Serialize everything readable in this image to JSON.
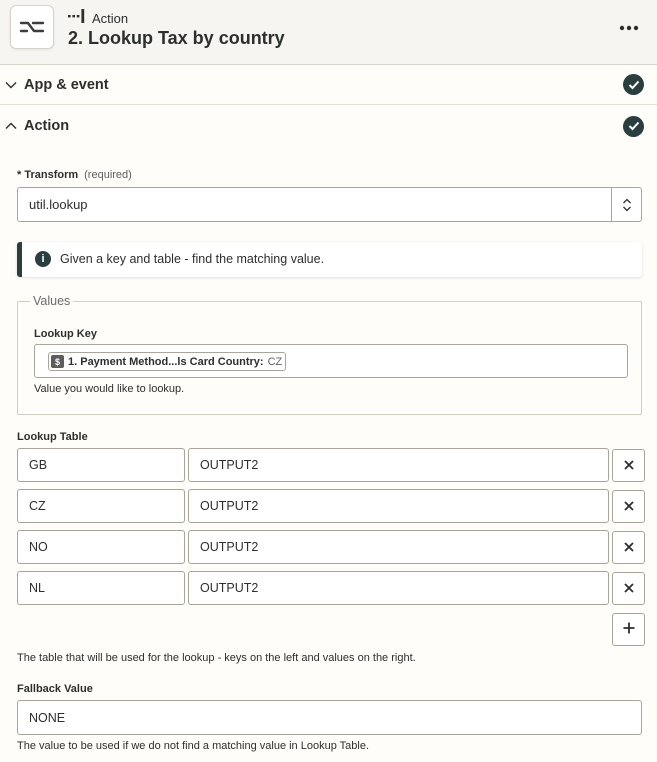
{
  "header": {
    "step_kind": "Action",
    "title": "2. Lookup Tax by country"
  },
  "sections": [
    {
      "label": "App & event",
      "expanded": false,
      "complete": true
    },
    {
      "label": "Action",
      "expanded": true,
      "complete": true
    }
  ],
  "transform": {
    "asterisk": "*",
    "label": "Transform",
    "required": "(required)",
    "value": "util.lookup"
  },
  "info": {
    "text": "Given a key and table - find the matching value."
  },
  "values_group": {
    "legend": "Values",
    "lookup_key": {
      "label": "Lookup Key",
      "pill_label": "1. Payment Method...ls Card Country:",
      "pill_value": "CZ",
      "help": "Value you would like to lookup."
    }
  },
  "lookup_table": {
    "label": "Lookup Table",
    "rows": [
      {
        "key": "GB",
        "value": "OUTPUT2"
      },
      {
        "key": "CZ",
        "value": "OUTPUT2"
      },
      {
        "key": "NO",
        "value": "OUTPUT2"
      },
      {
        "key": "NL",
        "value": "OUTPUT2"
      }
    ],
    "help": "The table that will be used for the lookup - keys on the left and values on the right."
  },
  "fallback": {
    "label": "Fallback Value",
    "value": "NONE",
    "help": "The value to be used if we do not find a matching value in Lookup Table."
  },
  "colors": {
    "accent_dark": "#2b3e3f",
    "header_bg": "#f7f5f2",
    "page_bg": "#fffdf9",
    "border": "#a9a59b"
  },
  "icons": {
    "app": "formatter-icon",
    "step_kind": "action-step-icon",
    "more": "more-horizontal-icon",
    "check": "check-circle-icon",
    "info": "info-icon",
    "select_toggle": "chevron-up-down-icon",
    "remove": "close-icon",
    "add": "plus-icon",
    "pill": "dollar-app-icon"
  }
}
